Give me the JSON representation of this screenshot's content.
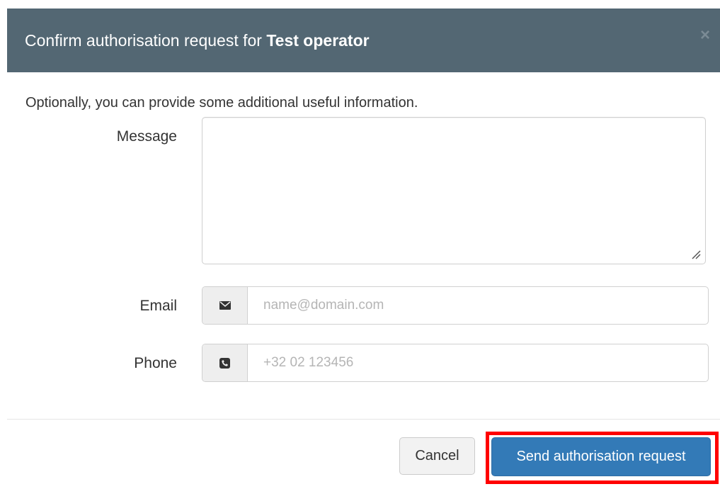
{
  "dialog": {
    "title_prefix": "Confirm authorisation request for",
    "title_subject": "Test operator",
    "close_label": "×"
  },
  "form": {
    "intro": "Optionally, you can provide some additional useful information.",
    "message": {
      "label": "Message",
      "value": ""
    },
    "email": {
      "label": "Email",
      "placeholder": "name@domain.com",
      "icon": "envelope-icon"
    },
    "phone": {
      "label": "Phone",
      "placeholder": "+32 02 123456",
      "icon": "phone-icon"
    }
  },
  "footer": {
    "cancel_label": "Cancel",
    "send_label": "Send authorisation request"
  },
  "colors": {
    "header_bg": "#536773",
    "primary": "#337ab7",
    "highlight": "#ff0000"
  }
}
